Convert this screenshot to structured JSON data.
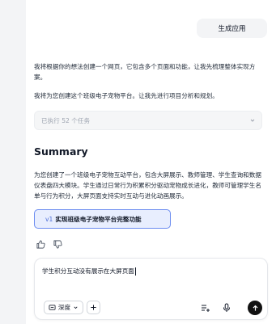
{
  "user_message": "生成应用",
  "assistant": {
    "intro": "我将根据你的想法创建一个网页，它包含多个页面和功能，让我先梳理整体实现方案。",
    "plan": "我将为您创建这个班级电子宠物平台。让我先进行项目分析和规划。",
    "tasks_label": "已执行 52 个任务",
    "summary_title": "Summary",
    "summary_text": "为您创建了一个班级电子宠物互动平台，包含大屏展示、教师管理、学生查询和数据仪表盘四大模块。学生通过日常行为积累积分驱动宠物成长进化，教师可管理学生名单与行为积分，大屏页面支持实时互动与进化动画展示。",
    "version_tag": "v1",
    "version_label": "实现班级电子宠物平台完整功能"
  },
  "composer": {
    "text": "学生积分互动没有展示在大屏页面",
    "mode_label": "深度"
  },
  "colors": {
    "accent": "#4f6fd8",
    "version_bg": "#e8eefe",
    "send_bg": "#111111"
  }
}
